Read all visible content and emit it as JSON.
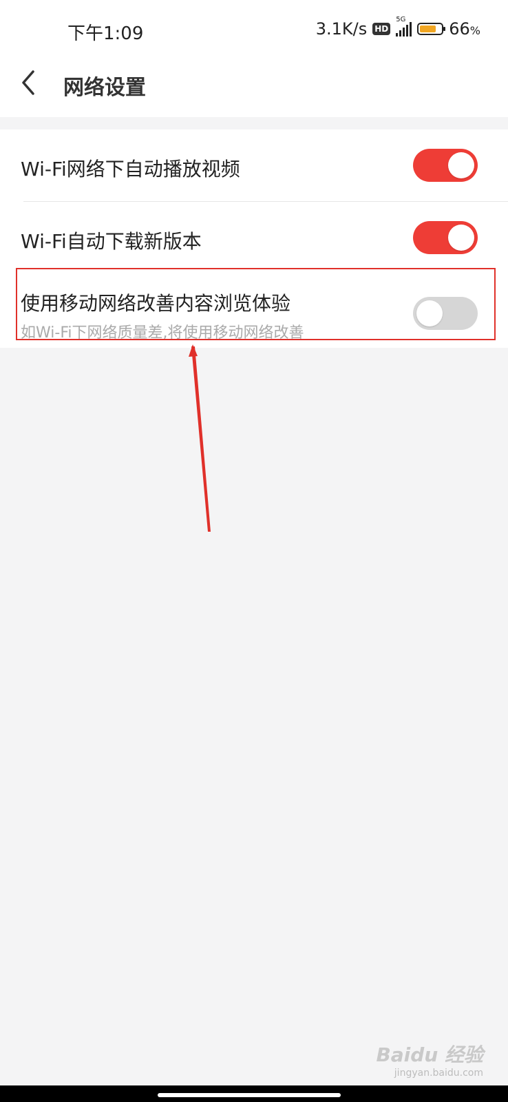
{
  "status_bar": {
    "time": "下午1:09",
    "net_speed": "3.1K/s",
    "hd_badge": "HD",
    "network_type": "5G",
    "battery_percent": "66",
    "battery_suffix": "%",
    "battery_color": "#f1a623"
  },
  "header": {
    "back_icon": "chevron-left-icon",
    "title": "网络设置"
  },
  "settings": [
    {
      "label": "Wi-Fi网络下自动播放视频",
      "enabled": true
    },
    {
      "label": "Wi-Fi自动下载新版本",
      "enabled": true
    },
    {
      "label": "使用移动网络改善内容浏览体验",
      "sublabel": "如Wi-Fi下网络质量差,将使用移动网络改善",
      "enabled": false
    }
  ],
  "colors": {
    "toggle_on": "#ee3d36",
    "toggle_off": "#d6d6d6",
    "annotation": "#e0302a",
    "background": "#f4f4f5"
  },
  "watermark": {
    "text": "Baidu 经验",
    "url": "jingyan.baidu.com"
  }
}
